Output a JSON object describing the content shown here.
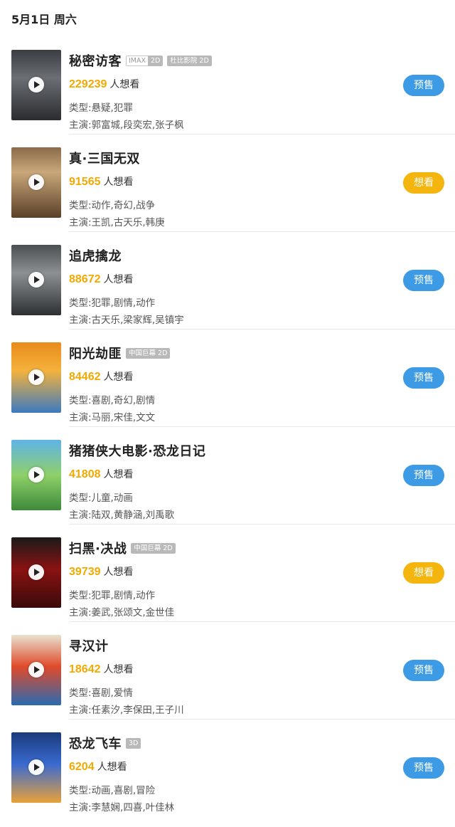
{
  "header": {
    "date": "5月1日 周六"
  },
  "want_suffix": "人想看",
  "movies": [
    {
      "title": "秘密访客",
      "tags": [
        "IMAX",
        "2D"
      ],
      "tags2": [
        "杜比影院 2D"
      ],
      "want_count": "229239",
      "genre": "类型:悬疑,犯罪",
      "cast": "主演:郭富城,段奕宏,张子枫",
      "action": "预售",
      "action_type": "presale"
    },
    {
      "title": "真·三国无双",
      "tags": [],
      "tags2": [],
      "want_count": "91565",
      "genre": "类型:动作,奇幻,战争",
      "cast": "主演:王凯,古天乐,韩庚",
      "action": "想看",
      "action_type": "want"
    },
    {
      "title": "追虎擒龙",
      "tags": [],
      "tags2": [],
      "want_count": "88672",
      "genre": "类型:犯罪,剧情,动作",
      "cast": "主演:古天乐,梁家辉,吴镇宇",
      "action": "预售",
      "action_type": "presale"
    },
    {
      "title": "阳光劫匪",
      "tags": [],
      "tags2": [
        "中国巨幕 2D"
      ],
      "want_count": "84462",
      "genre": "类型:喜剧,奇幻,剧情",
      "cast": "主演:马丽,宋佳,文文",
      "action": "预售",
      "action_type": "presale"
    },
    {
      "title": "猪猪侠大电影·恐龙日记",
      "tags": [],
      "tags2": [],
      "want_count": "41808",
      "genre": "类型:儿童,动画",
      "cast": "主演:陆双,黄静涵,刘禹歌",
      "action": "预售",
      "action_type": "presale"
    },
    {
      "title": "扫黑·决战",
      "tags": [],
      "tags2": [
        "中国巨幕 2D"
      ],
      "want_count": "39739",
      "genre": "类型:犯罪,剧情,动作",
      "cast": "主演:姜武,张颂文,金世佳",
      "action": "想看",
      "action_type": "want"
    },
    {
      "title": "寻汉计",
      "tags": [],
      "tags2": [],
      "want_count": "18642",
      "genre": "类型:喜剧,爱情",
      "cast": "主演:任素汐,李保田,王子川",
      "action": "预售",
      "action_type": "presale"
    },
    {
      "title": "恐龙飞车",
      "tags": [],
      "tags2": [
        "3D"
      ],
      "want_count": "6204",
      "genre": "类型:动画,喜剧,冒险",
      "cast": "主演:李慧娴,四喜,叶佳林",
      "action": "预售",
      "action_type": "presale"
    }
  ],
  "colors": {
    "want_count": "#f2a900",
    "presale_button": "#3d9be5",
    "want_button": "#f5b50f"
  },
  "icons": {
    "play": "play-icon"
  }
}
